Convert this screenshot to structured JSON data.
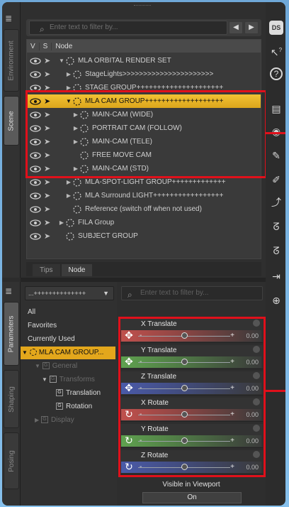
{
  "scene": {
    "side_tabs": {
      "environment": "Environment",
      "scene": "Scene"
    },
    "filter_placeholder": "Enter text to filter by...",
    "columns": {
      "visible": "V",
      "selectable": "S",
      "node": "Node"
    },
    "rows": [
      {
        "label": "MLA ORBITAL RENDER SET",
        "indent": 0,
        "expander": "▼"
      },
      {
        "label": "StageLights>>>>>>>>>>>>>>>>>>>>>>",
        "indent": 1,
        "expander": "▶"
      },
      {
        "label": "STAGE GROUP+++++++++++++++++++++",
        "indent": 1,
        "expander": "▶"
      },
      {
        "label": "MLA CAM GROUP+++++++++++++++++++",
        "indent": 1,
        "expander": "▼"
      },
      {
        "label": "MAIN-CAM (WIDE)",
        "indent": 2,
        "expander": "▶"
      },
      {
        "label": "PORTRAIT CAM (FOLLOW)",
        "indent": 2,
        "expander": "▶"
      },
      {
        "label": "MAIN-CAM (TELE)",
        "indent": 2,
        "expander": "▶"
      },
      {
        "label": "FREE MOVE CAM",
        "indent": 2,
        "expander": ""
      },
      {
        "label": "MAIN-CAM (STD)",
        "indent": 2,
        "expander": "▶"
      },
      {
        "label": "MLA-SPOT-LIGHT GROUP+++++++++++++",
        "indent": 1,
        "expander": "▶"
      },
      {
        "label": "MLA Surround LIGHT+++++++++++++++++",
        "indent": 1,
        "expander": "▶"
      },
      {
        "label": "Reference (switch off when not used)",
        "indent": 1,
        "expander": ""
      },
      {
        "label": "FILA Group",
        "indent": 0,
        "expander": "▶"
      },
      {
        "label": "SUBJECT GROUP",
        "indent": 0,
        "expander": ""
      }
    ],
    "tabs": {
      "tips": "Tips",
      "node": "Node"
    }
  },
  "toolbar": {
    "ds_logo": "DS",
    "help_pointer": "?",
    "help": "?"
  },
  "params": {
    "side_tabs": {
      "parameters": "Parameters",
      "shaping": "Shaping",
      "posing": "Posing"
    },
    "dropdown": "...++++++++++++++",
    "categories": {
      "all": "All",
      "favorites": "Favorites",
      "currently_used": "Currently Used",
      "selected_node": "MLA CAM GROUP...",
      "general": "General",
      "transforms": "Transforms",
      "translation": "Translation",
      "rotation": "Rotation",
      "display": "Display"
    },
    "filter_placeholder": "Enter text to filter by...",
    "sliders": [
      {
        "label": "X Translate",
        "value": "0.00",
        "color": "#c0504d",
        "knob": 0.5
      },
      {
        "label": "Y Translate",
        "value": "0.00",
        "color": "#5fa14f",
        "knob": 0.5
      },
      {
        "label": "Z Translate",
        "value": "0.00",
        "color": "#4a5aa8",
        "knob": 0.5
      },
      {
        "label": "X Rotate",
        "value": "0.00",
        "color": "#c0504d",
        "knob": 0.5
      },
      {
        "label": "Y Rotate",
        "value": "0.00",
        "color": "#5fa14f",
        "knob": 0.5
      },
      {
        "label": "Z Rotate",
        "value": "0.00",
        "color": "#4a5aa8",
        "knob": 0.5
      }
    ],
    "visible_in_viewport": {
      "label": "Visible in Viewport",
      "value": "On"
    }
  },
  "colors": {
    "selection": "#e3a71c",
    "highlight": "#e0101b"
  }
}
